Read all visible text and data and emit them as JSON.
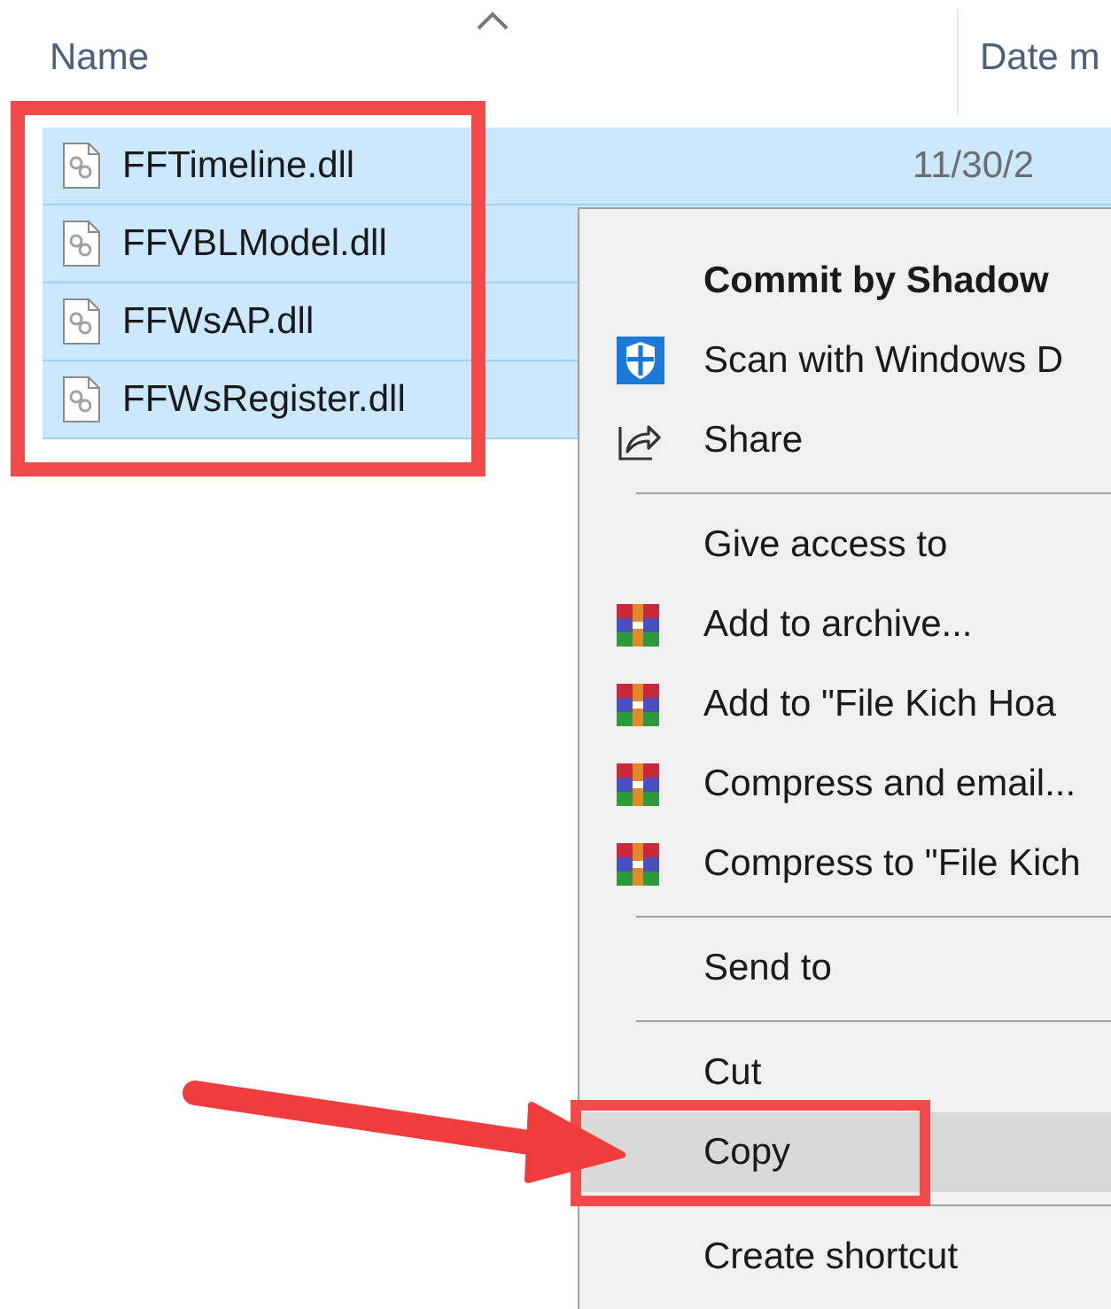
{
  "header": {
    "columns": [
      {
        "label": "Name"
      },
      {
        "label": "Date m"
      }
    ]
  },
  "files": [
    {
      "name": "FFTimeline.dll",
      "date": "11/30/2",
      "selected": true
    },
    {
      "name": "FFVBLModel.dll",
      "selected": true
    },
    {
      "name": "FFWsAP.dll",
      "selected": true
    },
    {
      "name": "FFWsRegister.dll",
      "selected": true
    }
  ],
  "context_menu": {
    "items": [
      {
        "kind": "heading",
        "label": "Commit by Shadow",
        "selected": false
      },
      {
        "kind": "shield",
        "label": "Scan with Windows D",
        "selected": false
      },
      {
        "kind": "share",
        "label": "Share",
        "selected": false
      },
      {
        "kind": "separator"
      },
      {
        "kind": "plain",
        "label": "Give access to",
        "selected": false
      },
      {
        "kind": "archive",
        "label": "Add to archive...",
        "selected": false
      },
      {
        "kind": "archive",
        "label": "Add to \"File Kich Hoa",
        "selected": false
      },
      {
        "kind": "archive",
        "label": "Compress and email...",
        "selected": false
      },
      {
        "kind": "archive",
        "label": "Compress to \"File Kich",
        "selected": false
      },
      {
        "kind": "separator"
      },
      {
        "kind": "plain",
        "label": "Send to",
        "selected": false
      },
      {
        "kind": "separator"
      },
      {
        "kind": "plain",
        "label": "Cut",
        "selected": false
      },
      {
        "kind": "plain",
        "label": "Copy",
        "selected": true
      },
      {
        "kind": "separator"
      },
      {
        "kind": "plain",
        "label": "Create shortcut",
        "selected": false
      }
    ]
  }
}
